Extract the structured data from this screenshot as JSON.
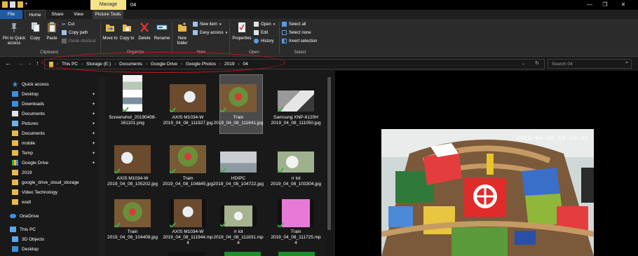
{
  "window": {
    "title": "04",
    "context_tab": "Manage",
    "minimize_glyph": "—",
    "maximize_glyph": "❐",
    "close_glyph": "✕"
  },
  "tabs": [
    "File",
    "Home",
    "Share",
    "View",
    "Picture Tools"
  ],
  "ribbon": {
    "clipboard": {
      "pin_label": "Pin to Quick access",
      "copy_label": "Copy",
      "paste_label": "Paste",
      "cut_label": "Cut",
      "copy_path_label": "Copy path",
      "paste_shortcut_label": "Paste shortcut",
      "group_label": "Clipboard"
    },
    "organize": {
      "move_to_label": "Move to",
      "copy_to_label": "Copy to",
      "delete_label": "Delete",
      "rename_label": "Rename",
      "group_label": "Organize"
    },
    "new": {
      "new_folder_label": "New folder",
      "new_item_label": "New item",
      "easy_access_label": "Easy access",
      "group_label": "New"
    },
    "open": {
      "properties_label": "Properties",
      "open_label": "Open",
      "edit_label": "Edit",
      "history_label": "History",
      "group_label": "Open"
    },
    "select": {
      "select_all_label": "Select all",
      "select_none_label": "Select none",
      "invert_label": "Invert selection",
      "group_label": "Select"
    }
  },
  "address": {
    "breadcrumbs": [
      "This PC",
      "Storage (E:)",
      "Documents",
      "Google Drive",
      "Google Photos",
      "2019",
      "04"
    ]
  },
  "search": {
    "placeholder": "Search 04"
  },
  "sidebar": {
    "items": [
      {
        "label": "Quick access",
        "icon": "star-icon"
      },
      {
        "label": "Desktop",
        "icon": "folder-icon",
        "pinned": true
      },
      {
        "label": "Downloads",
        "icon": "download-icon",
        "pinned": true
      },
      {
        "label": "Documents",
        "icon": "folder-icon",
        "pinned": true
      },
      {
        "label": "Pictures",
        "icon": "folder-icon",
        "pinned": true
      },
      {
        "label": "Documents",
        "icon": "folder-icon",
        "pinned": true
      },
      {
        "label": "mobile",
        "icon": "folder-icon",
        "pinned": true
      },
      {
        "label": "Temp",
        "icon": "folder-icon",
        "pinned": true
      },
      {
        "label": "Google Drive",
        "icon": "google-drive-icon",
        "pinned": true
      },
      {
        "label": "2019",
        "icon": "folder-icon"
      },
      {
        "label": "google_drive_cloud_storage",
        "icon": "folder-icon"
      },
      {
        "label": "Video Technology",
        "icon": "folder-icon"
      },
      {
        "label": "wsdl",
        "icon": "folder-icon"
      },
      {
        "label": "OneDrive",
        "icon": "onedrive-icon"
      },
      {
        "label": "This PC",
        "icon": "pc-icon"
      },
      {
        "label": "3D Objects",
        "icon": "3d-objects-icon"
      },
      {
        "label": "Desktop",
        "icon": "desktop-icon"
      }
    ]
  },
  "files": [
    {
      "name": "Screenshot_20190408-161101.png"
    },
    {
      "name": "AXIS M1034-W 2019_04_08_111927.jpg"
    },
    {
      "name": "Train 2019_04_08_111641.jpg",
      "selected": true
    },
    {
      "name": "Samsung XNP-6120H 2019_04_08_111050.jpg"
    },
    {
      "name": "AXIS M1034-W 2019_04_08_105202.jpg"
    },
    {
      "name": "Train 2019_04_08_104845.jpg"
    },
    {
      "name": "HDIPC 2019_04_08_104722.jpg"
    },
    {
      "name": "rr lot 2019_04_08_103304.jpg"
    },
    {
      "name": "Train 2019_04_08_104408.jpg"
    },
    {
      "name": "AXIS M1034-W 2019_04_08_111944.mp4"
    },
    {
      "name": "rr lot 2019_04_08_111831.mp4"
    },
    {
      "name": "Train 2019_04_08_111725.mp4"
    }
  ],
  "preview": {
    "timestamp": "2019-04-08 10:16:41"
  },
  "colors": {
    "accent": "#1e5aa8",
    "manage_tab": "#f6e48a",
    "check": "#3fae49",
    "highlight_ellipse": "#c0171c"
  }
}
